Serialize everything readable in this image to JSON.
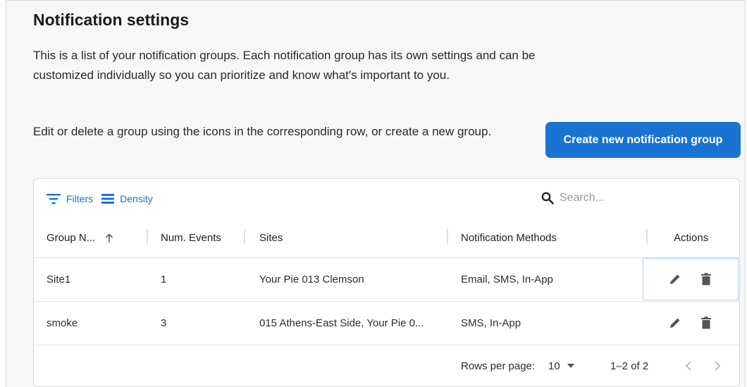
{
  "page": {
    "title": "Notification settings",
    "description": "This is a list of your notification groups. Each notification group has its own settings and can be customized individually so you can prioritize and know what's important to you.",
    "instructions": "Edit or delete a group using the icons in the corresponding row, or create a new group.",
    "create_button_label": "Create new notification group"
  },
  "toolbar": {
    "filters_label": "Filters",
    "density_label": "Density",
    "search_placeholder": "Search..."
  },
  "table": {
    "columns": {
      "group_name": "Group N...",
      "num_events": "Num. Events",
      "sites": "Sites",
      "methods": "Notification Methods",
      "actions": "Actions"
    },
    "rows": [
      {
        "group_name": "Site1",
        "num_events": "1",
        "sites": "Your Pie 013 Clemson",
        "methods": "Email, SMS, In-App"
      },
      {
        "group_name": "smoke",
        "num_events": "3",
        "sites": "015 Athens-East Side, Your Pie 0...",
        "methods": "SMS, In-App"
      }
    ]
  },
  "pagination": {
    "rows_per_page_label": "Rows per page:",
    "rows_per_page_value": "10",
    "range": "1–2 of 2"
  },
  "colors": {
    "accent": "#1a73d1",
    "icon": "#555555"
  },
  "icons": {
    "filter": "filter-icon",
    "density": "density-icon",
    "search": "search-icon",
    "sort": "arrow-up-icon",
    "edit": "pencil-icon",
    "delete": "trash-icon",
    "dropdown": "caret-down-icon",
    "prev": "chevron-left-icon",
    "next": "chevron-right-icon"
  }
}
